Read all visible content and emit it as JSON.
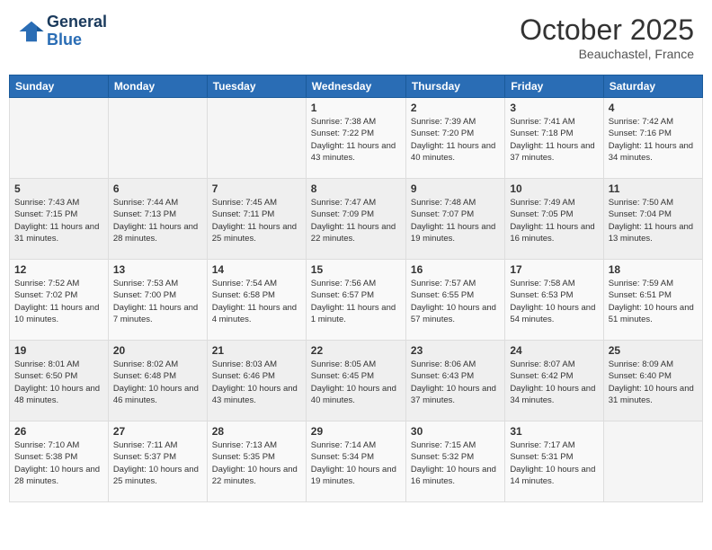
{
  "header": {
    "logo_line1": "General",
    "logo_line2": "Blue",
    "month": "October 2025",
    "location": "Beauchastel, France"
  },
  "weekdays": [
    "Sunday",
    "Monday",
    "Tuesday",
    "Wednesday",
    "Thursday",
    "Friday",
    "Saturday"
  ],
  "weeks": [
    [
      {
        "day": "",
        "sunrise": "",
        "sunset": "",
        "daylight": ""
      },
      {
        "day": "",
        "sunrise": "",
        "sunset": "",
        "daylight": ""
      },
      {
        "day": "",
        "sunrise": "",
        "sunset": "",
        "daylight": ""
      },
      {
        "day": "1",
        "sunrise": "Sunrise: 7:38 AM",
        "sunset": "Sunset: 7:22 PM",
        "daylight": "Daylight: 11 hours and 43 minutes."
      },
      {
        "day": "2",
        "sunrise": "Sunrise: 7:39 AM",
        "sunset": "Sunset: 7:20 PM",
        "daylight": "Daylight: 11 hours and 40 minutes."
      },
      {
        "day": "3",
        "sunrise": "Sunrise: 7:41 AM",
        "sunset": "Sunset: 7:18 PM",
        "daylight": "Daylight: 11 hours and 37 minutes."
      },
      {
        "day": "4",
        "sunrise": "Sunrise: 7:42 AM",
        "sunset": "Sunset: 7:16 PM",
        "daylight": "Daylight: 11 hours and 34 minutes."
      }
    ],
    [
      {
        "day": "5",
        "sunrise": "Sunrise: 7:43 AM",
        "sunset": "Sunset: 7:15 PM",
        "daylight": "Daylight: 11 hours and 31 minutes."
      },
      {
        "day": "6",
        "sunrise": "Sunrise: 7:44 AM",
        "sunset": "Sunset: 7:13 PM",
        "daylight": "Daylight: 11 hours and 28 minutes."
      },
      {
        "day": "7",
        "sunrise": "Sunrise: 7:45 AM",
        "sunset": "Sunset: 7:11 PM",
        "daylight": "Daylight: 11 hours and 25 minutes."
      },
      {
        "day": "8",
        "sunrise": "Sunrise: 7:47 AM",
        "sunset": "Sunset: 7:09 PM",
        "daylight": "Daylight: 11 hours and 22 minutes."
      },
      {
        "day": "9",
        "sunrise": "Sunrise: 7:48 AM",
        "sunset": "Sunset: 7:07 PM",
        "daylight": "Daylight: 11 hours and 19 minutes."
      },
      {
        "day": "10",
        "sunrise": "Sunrise: 7:49 AM",
        "sunset": "Sunset: 7:05 PM",
        "daylight": "Daylight: 11 hours and 16 minutes."
      },
      {
        "day": "11",
        "sunrise": "Sunrise: 7:50 AM",
        "sunset": "Sunset: 7:04 PM",
        "daylight": "Daylight: 11 hours and 13 minutes."
      }
    ],
    [
      {
        "day": "12",
        "sunrise": "Sunrise: 7:52 AM",
        "sunset": "Sunset: 7:02 PM",
        "daylight": "Daylight: 11 hours and 10 minutes."
      },
      {
        "day": "13",
        "sunrise": "Sunrise: 7:53 AM",
        "sunset": "Sunset: 7:00 PM",
        "daylight": "Daylight: 11 hours and 7 minutes."
      },
      {
        "day": "14",
        "sunrise": "Sunrise: 7:54 AM",
        "sunset": "Sunset: 6:58 PM",
        "daylight": "Daylight: 11 hours and 4 minutes."
      },
      {
        "day": "15",
        "sunrise": "Sunrise: 7:56 AM",
        "sunset": "Sunset: 6:57 PM",
        "daylight": "Daylight: 11 hours and 1 minute."
      },
      {
        "day": "16",
        "sunrise": "Sunrise: 7:57 AM",
        "sunset": "Sunset: 6:55 PM",
        "daylight": "Daylight: 10 hours and 57 minutes."
      },
      {
        "day": "17",
        "sunrise": "Sunrise: 7:58 AM",
        "sunset": "Sunset: 6:53 PM",
        "daylight": "Daylight: 10 hours and 54 minutes."
      },
      {
        "day": "18",
        "sunrise": "Sunrise: 7:59 AM",
        "sunset": "Sunset: 6:51 PM",
        "daylight": "Daylight: 10 hours and 51 minutes."
      }
    ],
    [
      {
        "day": "19",
        "sunrise": "Sunrise: 8:01 AM",
        "sunset": "Sunset: 6:50 PM",
        "daylight": "Daylight: 10 hours and 48 minutes."
      },
      {
        "day": "20",
        "sunrise": "Sunrise: 8:02 AM",
        "sunset": "Sunset: 6:48 PM",
        "daylight": "Daylight: 10 hours and 46 minutes."
      },
      {
        "day": "21",
        "sunrise": "Sunrise: 8:03 AM",
        "sunset": "Sunset: 6:46 PM",
        "daylight": "Daylight: 10 hours and 43 minutes."
      },
      {
        "day": "22",
        "sunrise": "Sunrise: 8:05 AM",
        "sunset": "Sunset: 6:45 PM",
        "daylight": "Daylight: 10 hours and 40 minutes."
      },
      {
        "day": "23",
        "sunrise": "Sunrise: 8:06 AM",
        "sunset": "Sunset: 6:43 PM",
        "daylight": "Daylight: 10 hours and 37 minutes."
      },
      {
        "day": "24",
        "sunrise": "Sunrise: 8:07 AM",
        "sunset": "Sunset: 6:42 PM",
        "daylight": "Daylight: 10 hours and 34 minutes."
      },
      {
        "day": "25",
        "sunrise": "Sunrise: 8:09 AM",
        "sunset": "Sunset: 6:40 PM",
        "daylight": "Daylight: 10 hours and 31 minutes."
      }
    ],
    [
      {
        "day": "26",
        "sunrise": "Sunrise: 7:10 AM",
        "sunset": "Sunset: 5:38 PM",
        "daylight": "Daylight: 10 hours and 28 minutes."
      },
      {
        "day": "27",
        "sunrise": "Sunrise: 7:11 AM",
        "sunset": "Sunset: 5:37 PM",
        "daylight": "Daylight: 10 hours and 25 minutes."
      },
      {
        "day": "28",
        "sunrise": "Sunrise: 7:13 AM",
        "sunset": "Sunset: 5:35 PM",
        "daylight": "Daylight: 10 hours and 22 minutes."
      },
      {
        "day": "29",
        "sunrise": "Sunrise: 7:14 AM",
        "sunset": "Sunset: 5:34 PM",
        "daylight": "Daylight: 10 hours and 19 minutes."
      },
      {
        "day": "30",
        "sunrise": "Sunrise: 7:15 AM",
        "sunset": "Sunset: 5:32 PM",
        "daylight": "Daylight: 10 hours and 16 minutes."
      },
      {
        "day": "31",
        "sunrise": "Sunrise: 7:17 AM",
        "sunset": "Sunset: 5:31 PM",
        "daylight": "Daylight: 10 hours and 14 minutes."
      },
      {
        "day": "",
        "sunrise": "",
        "sunset": "",
        "daylight": ""
      }
    ]
  ]
}
